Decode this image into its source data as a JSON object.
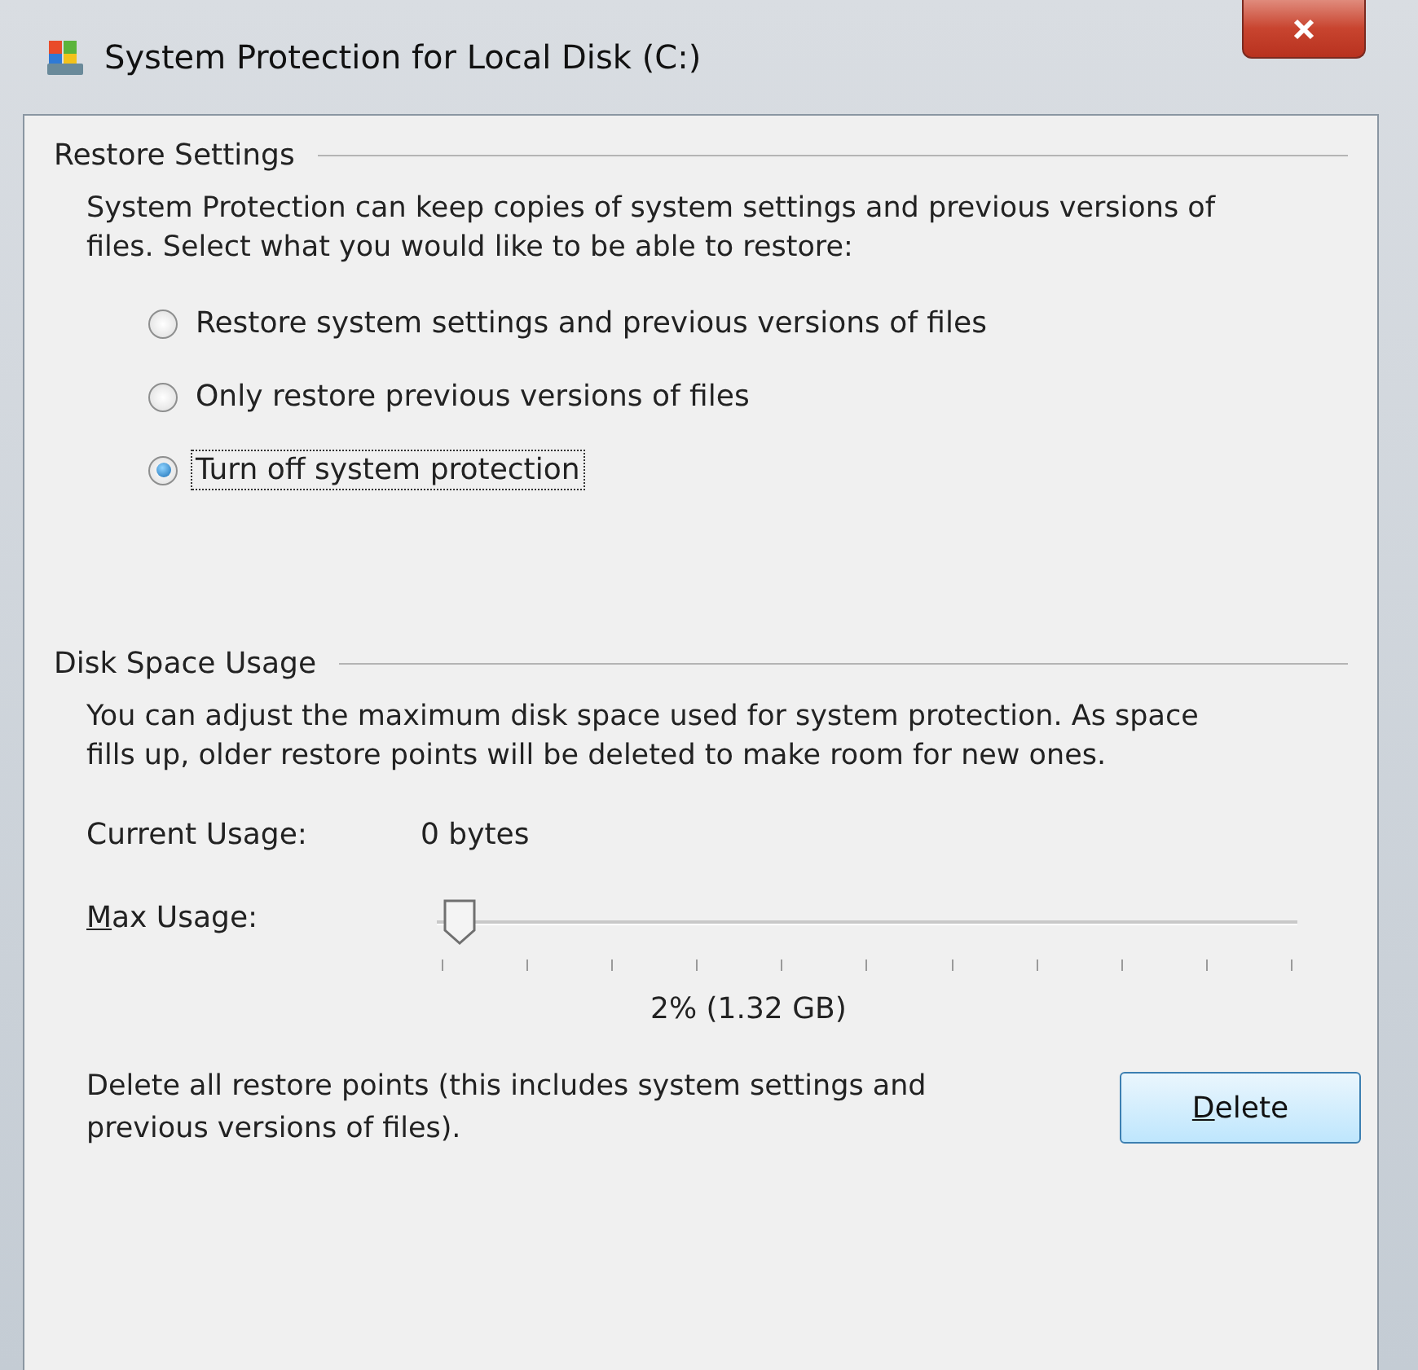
{
  "window": {
    "title": "System Protection for Local Disk (C:)"
  },
  "restore_settings": {
    "heading": "Restore Settings",
    "description": "System Protection can keep copies of system settings and previous versions of files. Select what you would like to be able to restore:",
    "options": [
      {
        "label": "Restore system settings and previous versions of files",
        "selected": false,
        "focused": false
      },
      {
        "label": "Only restore previous versions of files",
        "selected": false,
        "focused": false
      },
      {
        "label": "Turn off system protection",
        "selected": true,
        "focused": true
      }
    ]
  },
  "disk_space_usage": {
    "heading": "Disk Space Usage",
    "description": "You can adjust the maximum disk space used for system protection. As space fills up, older restore points will be deleted to make room for new ones.",
    "current_usage_label": "Current Usage:",
    "current_usage_value": "0 bytes",
    "max_usage": {
      "label": "Max Usage:",
      "level": 0.02,
      "reading": "2% (1.32 GB)"
    },
    "delete_text": "Delete all restore points (this includes system settings and previous versions of files).",
    "delete_button": "Delete"
  }
}
